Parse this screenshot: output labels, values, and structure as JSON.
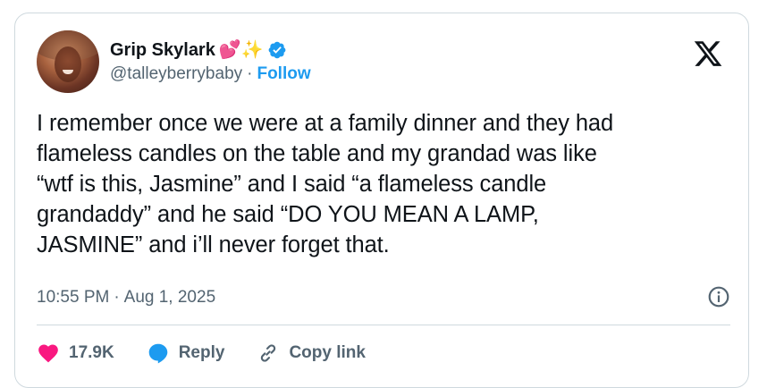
{
  "author": {
    "display_name": "Grip Skylark",
    "emojis": [
      "💕",
      "✨"
    ],
    "handle": "@talleyberrybaby",
    "separator": "·",
    "follow_label": "Follow",
    "verified": true,
    "verified_color": "#1d9bf0"
  },
  "platform_icon": "x-logo-icon",
  "tweet": {
    "text": "I remember once we were at a family dinner and they had\nflameless candles on the table and my grandad was like\n“wtf is this, Jasmine” and I said “a flameless candle\ngrandaddy” and he said “DO YOU MEAN A LAMP,\nJASMINE” and i’ll never forget that.",
    "time": "10:55 PM",
    "separator": "·",
    "date": "Aug 1, 2025"
  },
  "actions": {
    "like_count": "17.9K",
    "like_color": "#f91880",
    "reply_label": "Reply",
    "reply_color": "#1d9bf0",
    "copy_link_label": "Copy link"
  },
  "colors": {
    "text": "#0f1419",
    "secondary": "#536471",
    "accent": "#1d9bf0",
    "border": "#cfd9de"
  }
}
